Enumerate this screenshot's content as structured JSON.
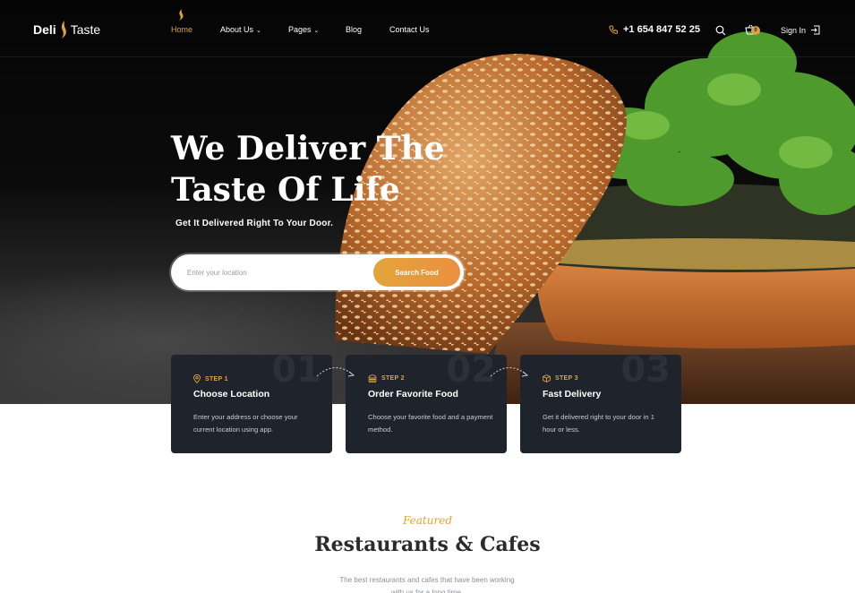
{
  "brand": {
    "name_bold": "Deli",
    "name_light": "Taste"
  },
  "nav": {
    "items": [
      {
        "label": "Home",
        "active": true,
        "has_dropdown": false
      },
      {
        "label": "About Us",
        "active": false,
        "has_dropdown": true
      },
      {
        "label": "Pages",
        "active": false,
        "has_dropdown": true
      },
      {
        "label": "Blog",
        "active": false,
        "has_dropdown": false
      },
      {
        "label": "Contact Us",
        "active": false,
        "has_dropdown": false
      }
    ],
    "caret": "⌄",
    "phone": "+1 654 847 52 25",
    "cart_count": "0",
    "signin_label": "Sign In"
  },
  "hero": {
    "title_line1": "We Deliver The",
    "title_line2": "Taste Of Life",
    "subtitle": "Get It Delivered Right To Your Door.",
    "search_placeholder": "Enter your location",
    "search_button": "Search Food"
  },
  "steps": [
    {
      "number": "01",
      "step_label": "STEP 1",
      "title": "Choose Location",
      "description": "Enter your address or choose your current location using app.",
      "icon": "location-pin-icon"
    },
    {
      "number": "02",
      "step_label": "STEP 2",
      "title": "Order Favorite Food",
      "description": "Choose your favorite food and a payment method.",
      "icon": "burger-icon"
    },
    {
      "number": "03",
      "step_label": "STEP 3",
      "title": "Fast Delivery",
      "description": "Get it delivered right to your door in 1 hour or less.",
      "icon": "package-icon"
    }
  ],
  "featured": {
    "script_label": "Featured",
    "title": "Restaurants & Cafes",
    "description": "The best restaurants and cafes that have been working with us for a long time."
  },
  "colors": {
    "accent": "#e0a23a",
    "dark_card": "#1f242c",
    "button_end": "#eb8f3e"
  }
}
